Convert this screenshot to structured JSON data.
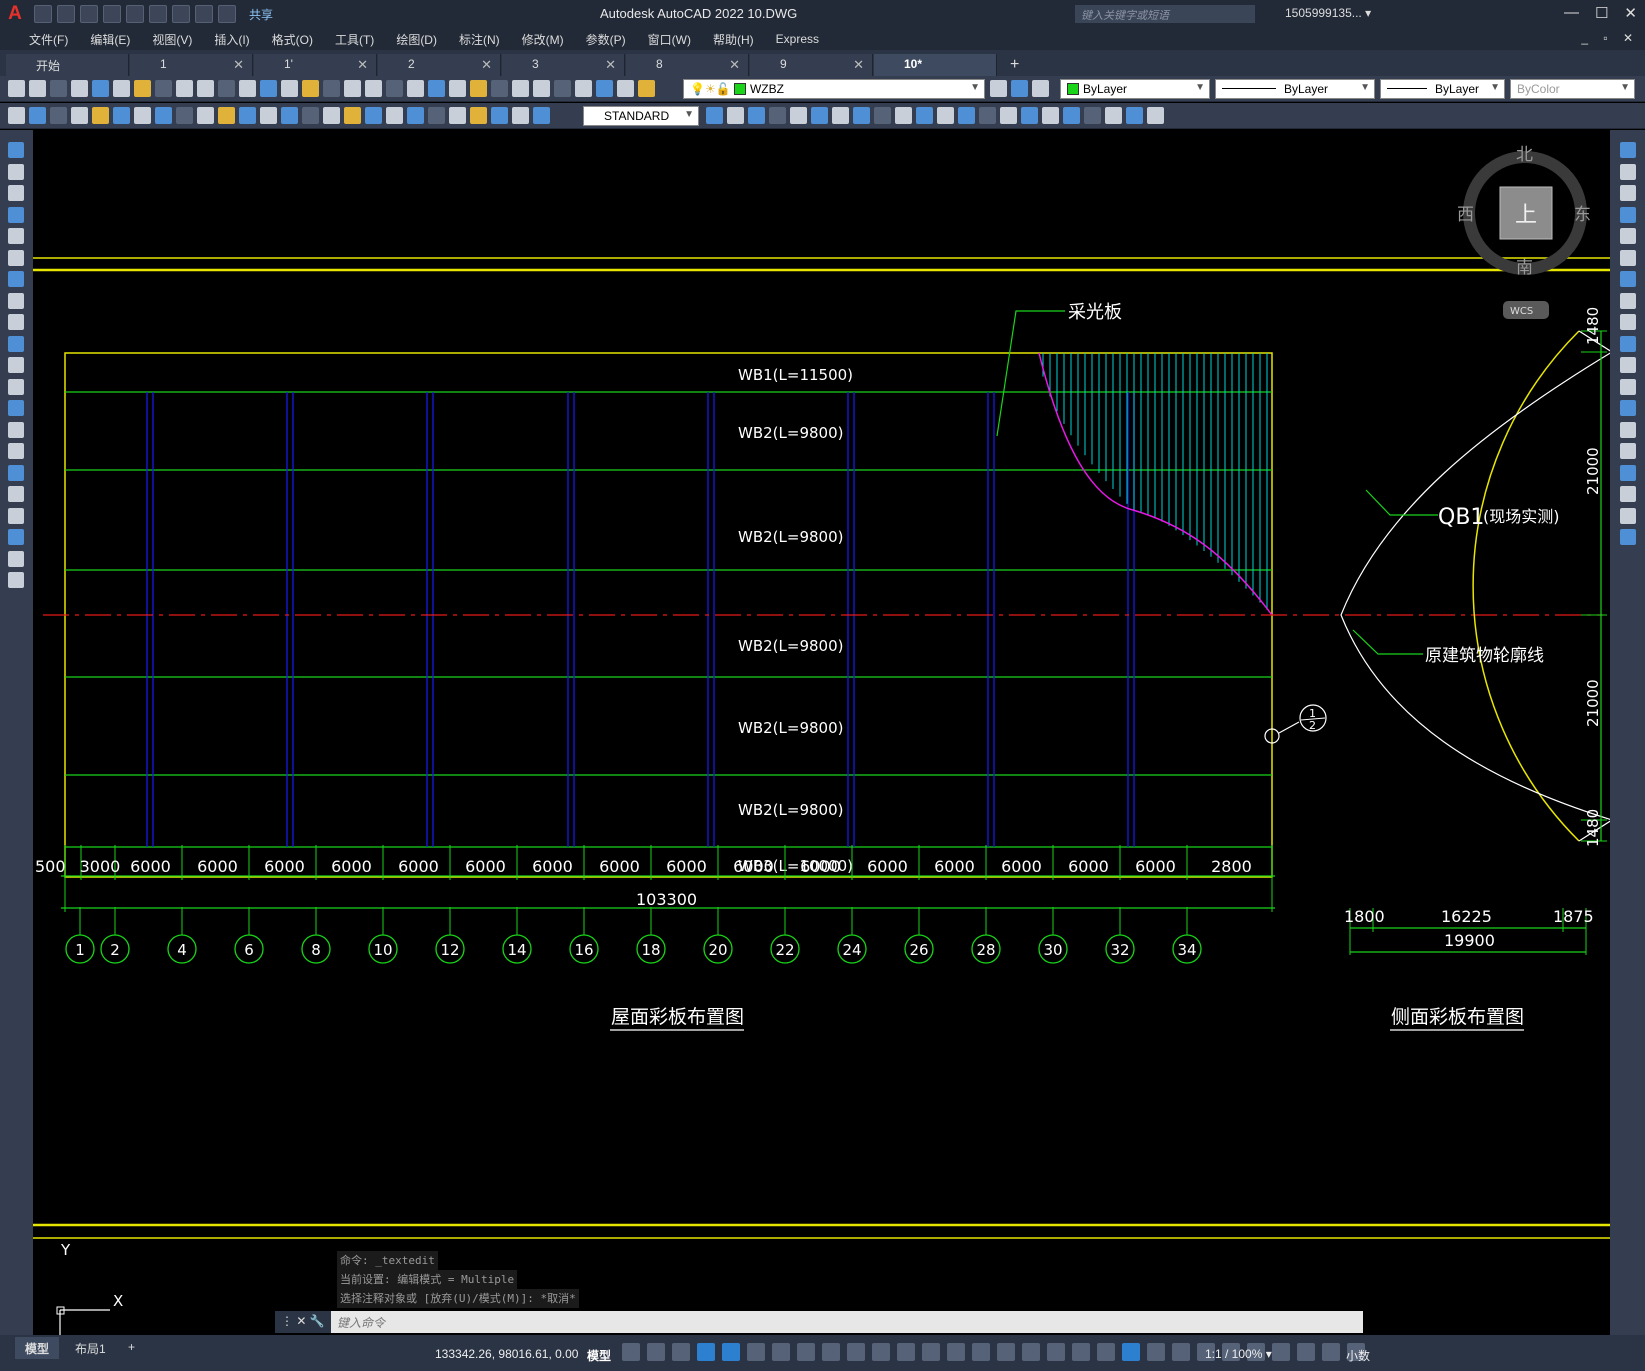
{
  "app": {
    "title": "Autodesk AutoCAD 2022    10.DWG",
    "share_label": "共享",
    "search_placeholder": "键入关键字或短语",
    "user": "1505999135... ▾"
  },
  "menu": [
    "文件(F)",
    "编辑(E)",
    "视图(V)",
    "插入(I)",
    "格式(O)",
    "工具(T)",
    "绘图(D)",
    "标注(N)",
    "修改(M)",
    "参数(P)",
    "窗口(W)",
    "帮助(H)",
    "Express"
  ],
  "tabs": [
    "开始",
    "1",
    "1'",
    "2",
    "3",
    "8",
    "9",
    "10*"
  ],
  "toolbar": {
    "layer": "WZBZ",
    "color": "ByLayer",
    "linetype": "ByLayer",
    "lineweight": "ByLayer",
    "plotstyle": "ByColor",
    "textstyle": "STANDARD"
  },
  "viewcube": {
    "north": "北",
    "south": "南",
    "east": "东",
    "west": "西",
    "top": "上",
    "wcs": "WCS"
  },
  "drawing": {
    "panels": [
      "WB1(L=11500)",
      "WB2(L=9800)",
      "WB2(L=9800)",
      "WB2(L=9800)",
      "WB2(L=9800)",
      "WB2(L=9800)",
      "WB3(L=10000)"
    ],
    "skylight_label": "采光板",
    "qb1_label": "QB1",
    "qb1_note": "(现场实测)",
    "outline_label": "原建筑物轮廓线",
    "bay_dims": [
      "500",
      "3000",
      "6000",
      "6000",
      "6000",
      "6000",
      "6000",
      "6000",
      "6000",
      "6000",
      "6000",
      "6000",
      "6000",
      "6000",
      "6000",
      "6000",
      "6000",
      "6000",
      "2800"
    ],
    "total_dim": "103300",
    "grid_axes": [
      "1",
      "2",
      "4",
      "6",
      "8",
      "10",
      "12",
      "14",
      "16",
      "18",
      "20",
      "22",
      "24",
      "26",
      "28",
      "30",
      "32",
      "34"
    ],
    "right_dims_vertical": [
      "1480",
      "21000",
      "21000",
      "1480"
    ],
    "right_dims_horizontal": [
      "1800",
      "16225",
      "1875"
    ],
    "right_total": "19900",
    "section_mark_top": "1",
    "section_mark_bottom": "2",
    "roof_title": "屋面彩板布置图",
    "side_title": "侧面彩板布置图",
    "ucs_x": "X",
    "ucs_y": "Y"
  },
  "command": {
    "history": [
      "命令: _textedit",
      "当前设置: 编辑模式 = Multiple",
      "选择注释对象或 [放弃(U)/模式(M)]: *取消*"
    ],
    "prompt": "键入命令"
  },
  "status": {
    "tabs": [
      "模型",
      "布局1"
    ],
    "coords": "133342.26, 98016.61, 0.00",
    "space": "模型",
    "scale": "1:1 / 100% ▾",
    "units": "小数"
  },
  "colors": {
    "chrome": "#222a37",
    "panel": "#343e50",
    "yellow": "#e6e600",
    "green": "#19d419",
    "blue": "#1a1ae6",
    "cyan": "#00d5d5",
    "magenta": "#e619e6",
    "red": "#e61919"
  }
}
